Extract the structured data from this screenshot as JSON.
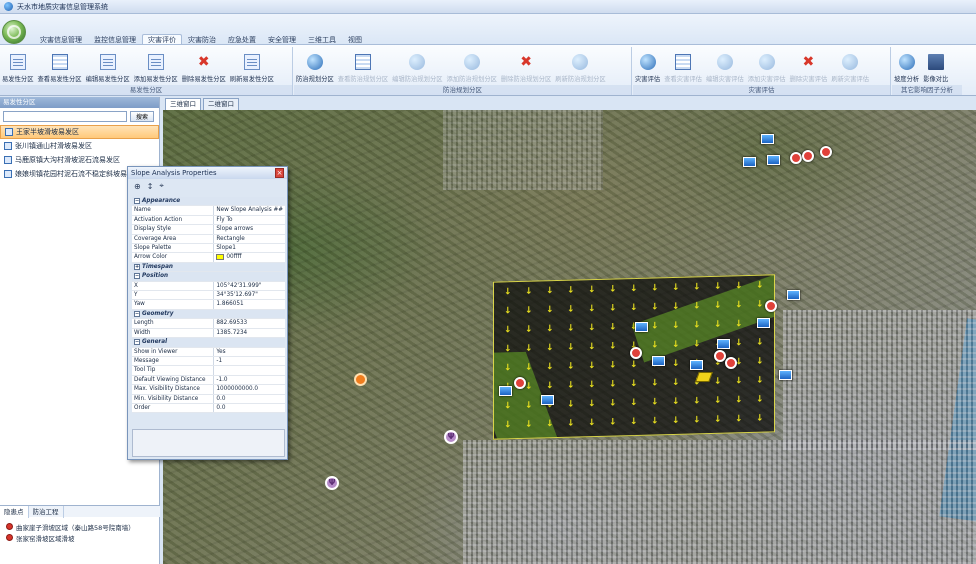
{
  "window": {
    "title": "天水市地质灾害信息管理系统"
  },
  "menu": {
    "tabs": [
      "灾害信息管理",
      "监控信息管理",
      "灾害评价",
      "灾害防治",
      "应急处置",
      "安全管理",
      "三维工具",
      "视图"
    ],
    "active": "灾害评价"
  },
  "ribbon": {
    "groups": [
      {
        "label": "易发性分区",
        "buttons": [
          "易发性分区",
          "查看易发性分区",
          "编辑易发性分区",
          "添加易发性分区",
          "删除易发性分区",
          "刷新易发性分区"
        ],
        "icons": [
          "doc-icon",
          "grid-icon",
          "edit-area-icon",
          "add-area-icon",
          "delete-icon",
          "refresh-area-icon"
        ]
      },
      {
        "label": "防治规划分区",
        "buttons": [
          "防治规划分区",
          "查看防治规划分区",
          "编辑防治规划分区",
          "添加防治规划分区",
          "删除防治规划分区",
          "刷新防治规划分区"
        ],
        "icons": [
          "globe-icon",
          "grid-icon",
          "edit-globe-icon",
          "add-globe-icon",
          "delete-icon",
          "refresh-globe-icon"
        ]
      },
      {
        "label": "灾害评估",
        "buttons": [
          "灾害评估",
          "查看灾害评估",
          "编辑灾害评估",
          "添加灾害评估",
          "删除灾害评估",
          "刷新灾害评估"
        ],
        "icons": [
          "globe-icon",
          "grid-icon",
          "edit-globe-icon",
          "add-globe-icon",
          "delete-icon",
          "refresh-globe-icon"
        ]
      },
      {
        "label": "其它影响因子分析",
        "buttons": [
          "坡度分析",
          "影像对比"
        ],
        "icons": [
          "slope-icon",
          "compare-icon"
        ]
      }
    ]
  },
  "left_panel": {
    "title": "易发性分区",
    "search_button": "搜索",
    "search_value": "",
    "items": [
      "王家半坡滑坡易发区",
      "张川镇通山村滑坡易发区",
      "马鹿原镇大沟村滑坡泥石流易发区",
      "娘娘坝镇花园村泥石流不稳定斜坡易发区"
    ],
    "selected_index": 0,
    "bottom_tabs": [
      "隐患点",
      "防治工程"
    ],
    "bottom_active": "隐患点",
    "hazard_points": [
      "曲家崖子滑坡区域（秦山路58号院南墙）",
      "张家窑滑坡区域滑坡"
    ]
  },
  "viewer": {
    "tabs": [
      "三维窗口",
      "二维窗口"
    ],
    "active": "三维窗口"
  },
  "properties": {
    "title": "Slope Analysis Properties",
    "categories": [
      {
        "name": "Appearance",
        "expanded": true,
        "rows": [
          [
            "Name",
            "New Slope Analysis ##"
          ],
          [
            "Activation Action",
            "Fly To"
          ],
          [
            "Display Style",
            "Slope arrows"
          ],
          [
            "Coverage Area",
            "Rectangle"
          ],
          [
            "Slope Palette",
            "Slope1"
          ],
          [
            "Arrow Color",
            "00ffff"
          ]
        ]
      },
      {
        "name": "Timespan",
        "expanded": false,
        "rows": []
      },
      {
        "name": "Position",
        "expanded": true,
        "rows": [
          [
            "X",
            "105°42'31.999\""
          ],
          [
            "Y",
            "34°35'12.697\""
          ],
          [
            "Yaw",
            "1.866051"
          ]
        ]
      },
      {
        "name": "Geometry",
        "expanded": true,
        "rows": [
          [
            "Length",
            "882.69533"
          ],
          [
            "Width",
            "1385.7234"
          ]
        ]
      },
      {
        "name": "General",
        "expanded": true,
        "rows": [
          [
            "Show in Viewer",
            "Yes"
          ],
          [
            "Message",
            "-1"
          ],
          [
            "Tool Tip",
            ""
          ],
          [
            "Default Viewing Distance",
            "-1.0"
          ],
          [
            "Max. Visibility Distance",
            "1000000000.0"
          ],
          [
            "Min. Visibility Distance",
            "0.0"
          ],
          [
            "Order",
            "0.0"
          ]
        ]
      }
    ],
    "arrow_swatch_color": "#ffff00"
  },
  "colors": {
    "accent": "#f07d1e",
    "selected_item": "#ffc97a",
    "hazard": "#e0413a",
    "slope_arrow": "#e8df1f"
  }
}
